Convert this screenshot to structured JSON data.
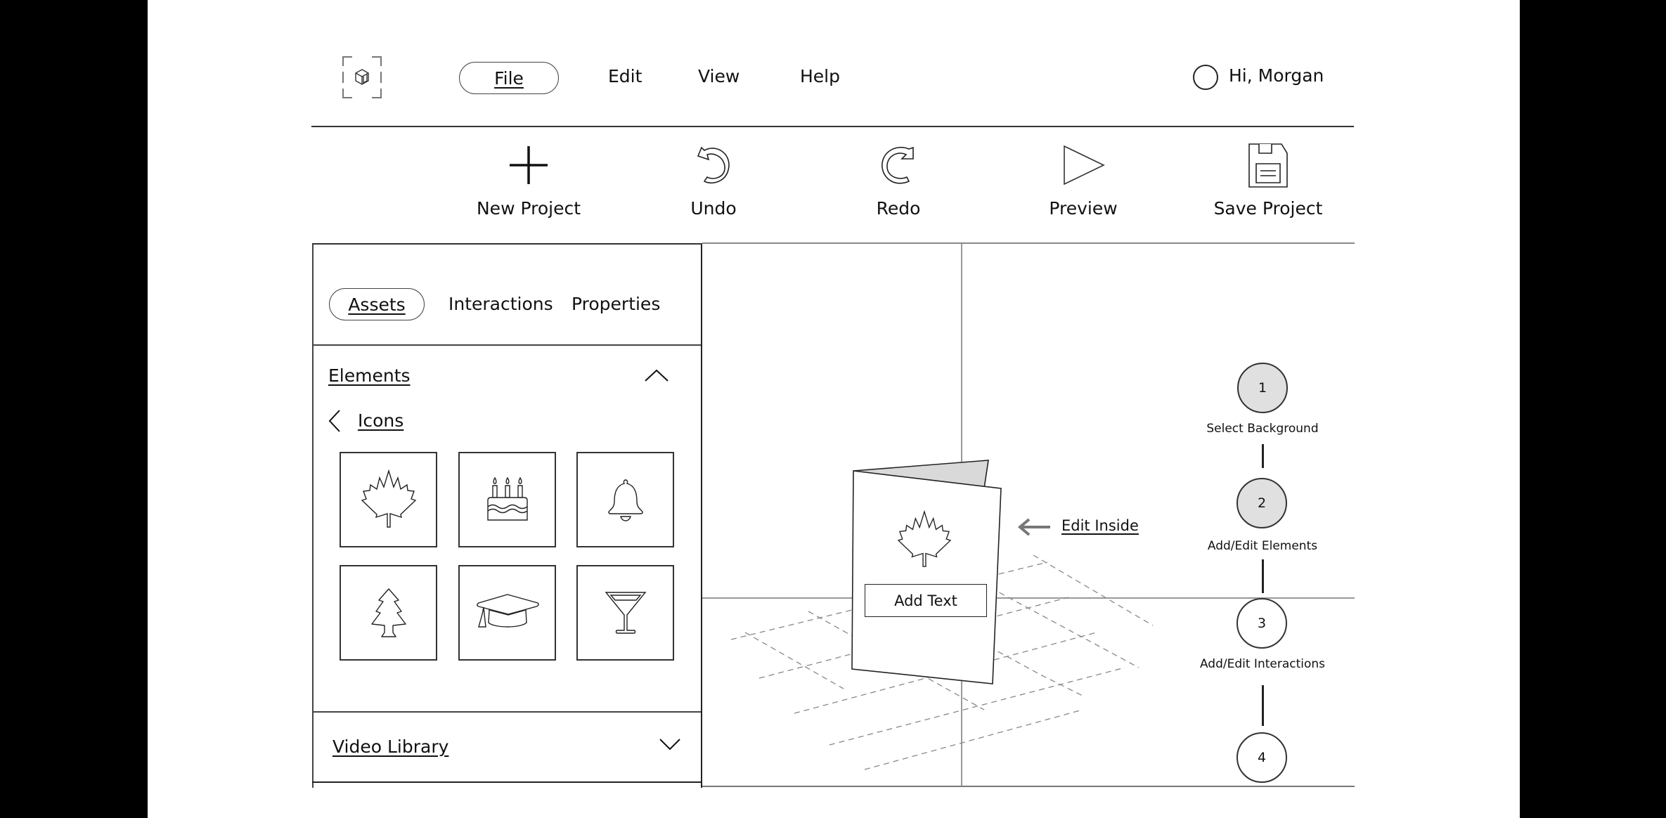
{
  "header": {
    "logo_icon": "cube-icon",
    "menu": [
      {
        "label": "File",
        "active": true
      },
      {
        "label": "Edit",
        "active": false
      },
      {
        "label": "View",
        "active": false
      },
      {
        "label": "Help",
        "active": false
      }
    ],
    "greeting": "Hi, Morgan"
  },
  "toolbar": {
    "items": [
      {
        "label": "New Project",
        "icon": "plus-icon"
      },
      {
        "label": "Undo",
        "icon": "undo-icon"
      },
      {
        "label": "Redo",
        "icon": "redo-icon"
      },
      {
        "label": "Preview",
        "icon": "play-icon"
      },
      {
        "label": "Save Project",
        "icon": "floppy-disk-icon"
      }
    ]
  },
  "panel": {
    "tabs": [
      {
        "label": "Assets",
        "active": true
      },
      {
        "label": "Interactions",
        "active": false
      },
      {
        "label": "Properties",
        "active": false
      }
    ],
    "elements_section": {
      "title": "Elements",
      "expanded": true,
      "subcategory": "Icons",
      "icons": [
        {
          "name": "maple-leaf-icon"
        },
        {
          "name": "birthday-cake-icon"
        },
        {
          "name": "bell-icon"
        },
        {
          "name": "pine-tree-icon"
        },
        {
          "name": "graduation-cap-icon"
        },
        {
          "name": "cocktail-glass-icon"
        }
      ]
    },
    "video_section": {
      "title": "Video Library",
      "expanded": false
    }
  },
  "canvas": {
    "card": {
      "icon": "maple-leaf-icon",
      "text_box_label": "Add Text",
      "flap_color": "#d9d9d9"
    },
    "edit_inside_label": "Edit Inside"
  },
  "stepper": {
    "steps": [
      {
        "number": "1",
        "label": "Select Background",
        "completed": true
      },
      {
        "number": "2",
        "label": "Add/Edit Elements",
        "completed": true
      },
      {
        "number": "3",
        "label": "Add/Edit Interactions",
        "completed": false
      },
      {
        "number": "4",
        "label": "",
        "completed": false
      }
    ],
    "completed_color": "#e0e0e0"
  }
}
